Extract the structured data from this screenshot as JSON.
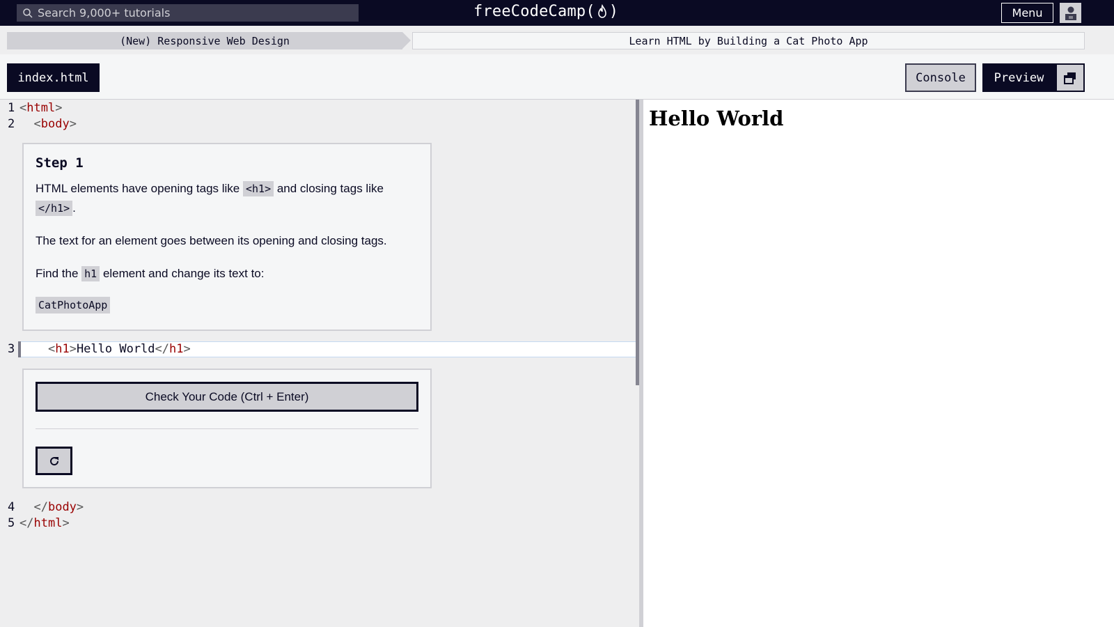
{
  "nav": {
    "search_placeholder": "Search 9,000+ tutorials",
    "brand_left": "freeCodeCamp(",
    "brand_right": ")",
    "menu_label": "Menu"
  },
  "breadcrumb": {
    "course": "(New) Responsive Web Design",
    "project": "Learn HTML by Building a Cat Photo App"
  },
  "toolbar": {
    "file_tab": "index.html",
    "console_label": "Console",
    "preview_label": "Preview"
  },
  "editor": {
    "lines": [
      {
        "num": "1",
        "indent": "",
        "open": "html"
      },
      {
        "num": "2",
        "indent": "  ",
        "open": "body"
      },
      {
        "num": "3",
        "indent": "    ",
        "tag": "h1",
        "text": "Hello World"
      },
      {
        "num": "4",
        "indent": "  ",
        "close": "body"
      },
      {
        "num": "5",
        "indent": "",
        "close": "html"
      }
    ]
  },
  "step": {
    "title": "Step 1",
    "p1_a": "HTML elements have opening tags like ",
    "p1_code1": "<h1>",
    "p1_b": " and closing tags like ",
    "p1_code2": "</h1>",
    "p1_c": ".",
    "p2": "The text for an element goes between its opening and closing tags.",
    "p3_a": "Find the ",
    "p3_code": "h1",
    "p3_b": " element and change its text to:",
    "target_text": "CatPhotoApp"
  },
  "check": {
    "button_label": "Check Your Code (Ctrl + Enter)"
  },
  "preview": {
    "heading": "Hello World"
  },
  "colors": {
    "nav_bg": "#0a0a23",
    "tag": "#990000",
    "panel": "#f5f6f7",
    "gray": "#d0d0d5"
  }
}
